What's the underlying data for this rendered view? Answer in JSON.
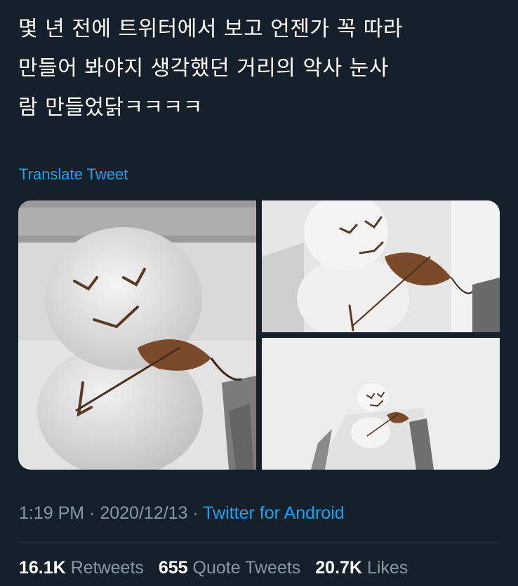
{
  "tweet": {
    "text": "몇 년 전에 트위터에서 보고 언젠가 꼭 따라\n만들어 봐야지 생각했던 거리의 악사 눈사\n람 만들었닭ㅋㅋㅋㅋ",
    "translate_label": "Translate Tweet"
  },
  "media": {
    "photos": [
      {
        "description": "snowman-closeup"
      },
      {
        "description": "snowman-side"
      },
      {
        "description": "snowman-wide"
      }
    ]
  },
  "meta": {
    "time": "1:19 PM",
    "sep1": " · ",
    "date": "2020/12/13",
    "sep2": " · ",
    "source": "Twitter for Android"
  },
  "stats": {
    "retweets_count": "16.1K",
    "retweets_label": "Retweets",
    "quote_count": "655",
    "quote_label": "Quote Tweets",
    "likes_count": "20.7K",
    "likes_label": "Likes"
  },
  "colors": {
    "background": "#15202b",
    "accent": "#1da1f2",
    "secondary_text": "#8899a6",
    "divider": "#38444d"
  }
}
